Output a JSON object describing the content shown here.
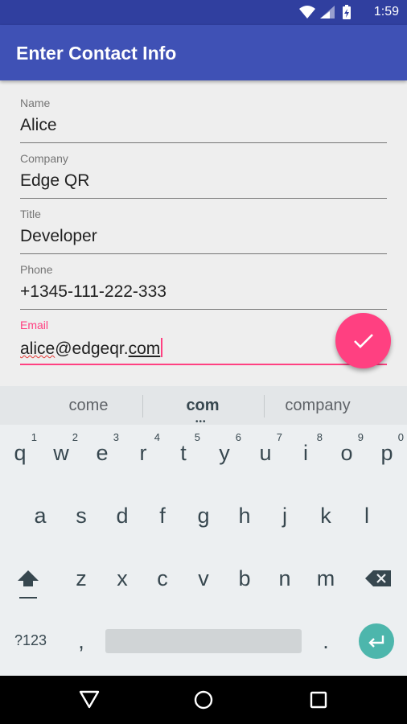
{
  "status_bar": {
    "time": "1:59",
    "icons": [
      "wifi-icon",
      "signal-icon",
      "battery-charging-icon"
    ]
  },
  "app_bar": {
    "title": "Enter Contact Info"
  },
  "form": {
    "fields": [
      {
        "label": "Name",
        "value": "Alice"
      },
      {
        "label": "Company",
        "value": "Edge QR"
      },
      {
        "label": "Title",
        "value": "Developer"
      },
      {
        "label": "Phone",
        "value": "+1345-111-222-333"
      },
      {
        "label": "Email",
        "value_part1": "alice",
        "value_part2": "@edgeqr.",
        "value_part3": "com"
      }
    ]
  },
  "fab": {
    "icon": "check-icon",
    "color": "#ff4081"
  },
  "suggestions": [
    "come",
    "com",
    "company"
  ],
  "keyboard": {
    "row1": [
      {
        "ch": "q",
        "num": "1"
      },
      {
        "ch": "w",
        "num": "2"
      },
      {
        "ch": "e",
        "num": "3"
      },
      {
        "ch": "r",
        "num": "4"
      },
      {
        "ch": "t",
        "num": "5"
      },
      {
        "ch": "y",
        "num": "6"
      },
      {
        "ch": "u",
        "num": "7"
      },
      {
        "ch": "i",
        "num": "8"
      },
      {
        "ch": "o",
        "num": "9"
      },
      {
        "ch": "p",
        "num": "0"
      }
    ],
    "row2": [
      "a",
      "s",
      "d",
      "f",
      "g",
      "h",
      "j",
      "k",
      "l"
    ],
    "row3": [
      "z",
      "x",
      "c",
      "v",
      "b",
      "n",
      "m"
    ],
    "symbols_label": "?123",
    "comma": ",",
    "period": ".",
    "shift_icon": "shift-icon",
    "backspace_icon": "backspace-icon",
    "enter_icon": "enter-icon"
  },
  "nav_bar": {
    "icons": [
      "back-icon",
      "home-icon",
      "recents-icon"
    ]
  },
  "colors": {
    "primary": "#3f51b5",
    "primary_dark": "#303f9f",
    "accent": "#ff4081",
    "enter_key": "#4db6ac"
  }
}
